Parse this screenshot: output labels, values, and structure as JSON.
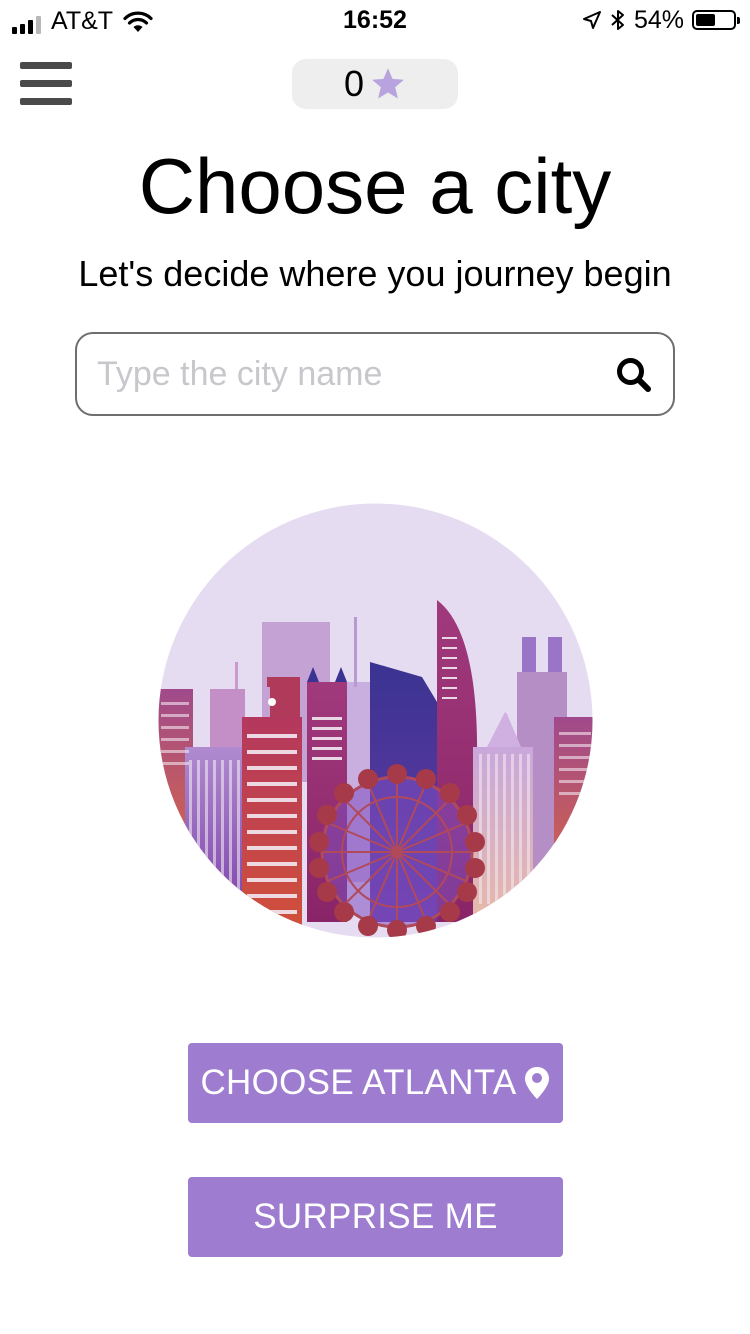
{
  "status_bar": {
    "carrier": "AT&T",
    "time": "16:52",
    "battery_percent": "54%",
    "battery_level": 0.54,
    "signal_bars_on": 3,
    "icons": [
      "signal-icon",
      "wifi-icon",
      "location-arrow-icon",
      "bluetooth-icon",
      "battery-icon"
    ]
  },
  "header": {
    "menu_icon": "hamburger-menu-icon",
    "score": "0",
    "score_icon": "star-icon"
  },
  "main": {
    "title": "Choose a city",
    "subtitle": "Let's decide where you journey begin",
    "search": {
      "placeholder": "Type the city name",
      "value": "",
      "icon": "search-icon"
    },
    "illustration_icon": "city-skyline-illustration"
  },
  "buttons": {
    "choose_label": "CHOOSE ATLANTA",
    "choose_icon": "map-pin-icon",
    "surprise_label": "SURPRISE ME"
  },
  "colors": {
    "accent": "#9e7ccf",
    "star": "#b9a3de",
    "pill_bg": "#eeeeee",
    "illustration_sky": "#e6dcf2"
  }
}
